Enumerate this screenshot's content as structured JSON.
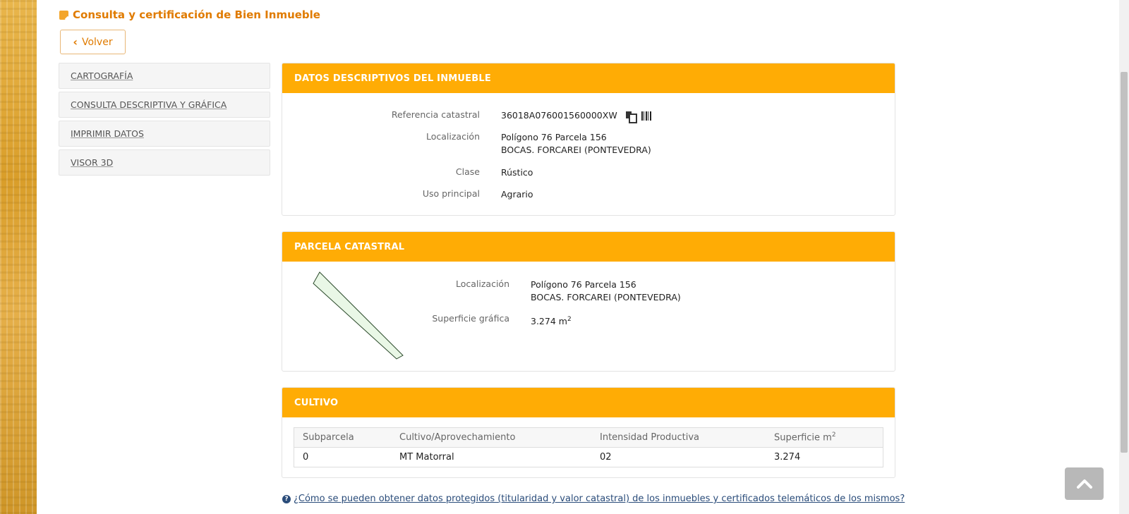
{
  "page": {
    "title": "Consulta y certificación de Bien Inmueble",
    "back_label": "Volver"
  },
  "sidebar": {
    "items": [
      {
        "label": "CARTOGRAFÍA"
      },
      {
        "label": "CONSULTA DESCRIPTIVA Y GRÁFICA"
      },
      {
        "label": "IMPRIMIR DATOS"
      },
      {
        "label": "VISOR 3D"
      }
    ]
  },
  "datos": {
    "header": "DATOS DESCRIPTIVOS DEL INMUEBLE",
    "ref_label": "Referencia catastral",
    "ref_value": "36018A076001560000XW",
    "loc_label": "Localización",
    "loc_line1": "Polígono 76 Parcela 156",
    "loc_line2": "BOCAS. FORCAREI (PONTEVEDRA)",
    "clase_label": "Clase",
    "clase_value": "Rústico",
    "uso_label": "Uso principal",
    "uso_value": "Agrario"
  },
  "parcela": {
    "header": "PARCELA CATASTRAL",
    "loc_label": "Localización",
    "loc_line1": "Polígono 76 Parcela 156",
    "loc_line2": "BOCAS. FORCAREI (PONTEVEDRA)",
    "sup_label": "Superficie gráfica",
    "sup_value": "3.274 m",
    "sup_unit_sup": "2",
    "shape_fill": "#e9f7e6"
  },
  "cultivo": {
    "header": "CULTIVO",
    "columns": [
      "Subparcela",
      "Cultivo/Aprovechamiento",
      "Intensidad Productiva",
      "Superficie m"
    ],
    "col4_sup": "2",
    "rows": [
      {
        "subparcela": "0",
        "cultivo": "MT Matorral",
        "intensidad": "02",
        "superficie": "3.274"
      }
    ]
  },
  "help": {
    "link_text": "¿Cómo se pueden obtener datos protegidos (titularidad y valor catastral) de los inmuebles y certificados telemáticos de los mismos?"
  },
  "colors": {
    "accent": "#ffac05",
    "title": "#e07b00",
    "link": "#2a4c7a"
  }
}
